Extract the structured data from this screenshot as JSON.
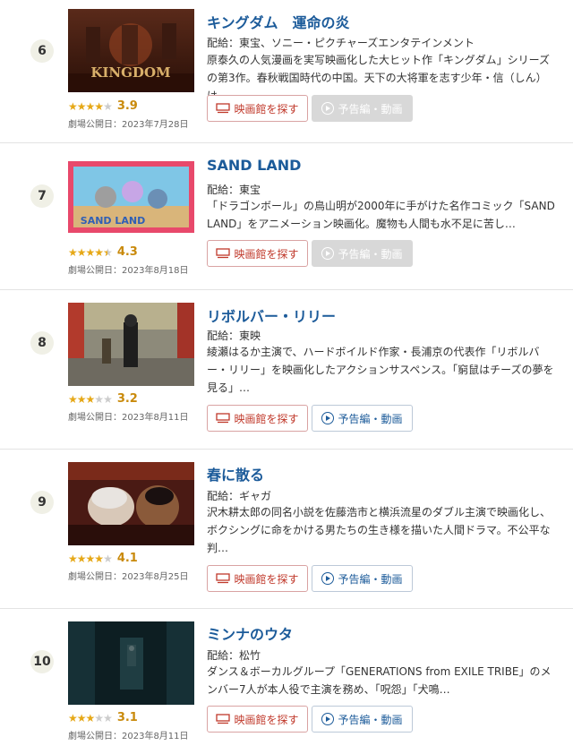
{
  "buttons": {
    "theater": "映画館を探す",
    "trailer": "予告編・動画"
  },
  "items": [
    {
      "rank": "6",
      "title": "キングダム　運命の炎",
      "distributor": "配給：東宝、ソニー・ピクチャーズエンタテインメント",
      "description": "原泰久の人気漫画を実写映画化した大ヒット作「キングダム」シリーズの第3作。春秋戦国時代の中国。天下の大将軍を志す少年・信（しん）は…",
      "score": "3.9",
      "rating": 3.9,
      "date": "劇場公開日：2023年7月28日",
      "trailer_available": false,
      "poster_text": "KINGDOM"
    },
    {
      "rank": "7",
      "title": "SAND LAND",
      "distributor": "配給：東宝",
      "description": "「ドラゴンボール」の鳥山明が2000年に手がけた名作コミック「SAND LAND」をアニメーション映画化。魔物も人間も水不足に苦し…",
      "score": "4.3",
      "rating": 4.3,
      "date": "劇場公開日：2023年8月18日",
      "trailer_available": false,
      "poster_text": "SAND LAND"
    },
    {
      "rank": "8",
      "title": "リボルバー・リリー",
      "distributor": "配給：東映",
      "description": "綾瀬はるか主演で、ハードボイルド作家・長浦京の代表作「リボルバー・リリー」を映画化したアクションサスペンス。「窮鼠はチーズの夢を見る」…",
      "score": "3.2",
      "rating": 3.2,
      "date": "劇場公開日：2023年8月11日",
      "trailer_available": true,
      "poster_text": ""
    },
    {
      "rank": "9",
      "title": "春に散る",
      "distributor": "配給：ギャガ",
      "description": "沢木耕太郎の同名小説を佐藤浩市と横浜流星のダブル主演で映画化し、ボクシングに命をかける男たちの生き様を描いた人間ドラマ。不公平な判…",
      "score": "4.1",
      "rating": 4.1,
      "date": "劇場公開日：2023年8月25日",
      "trailer_available": true,
      "poster_text": ""
    },
    {
      "rank": "10",
      "title": "ミンナのウタ",
      "distributor": "配給：松竹",
      "description": "ダンス＆ボーカルグループ「GENERATIONS from EXILE TRIBE」のメンバー7人が本人役で主演を務め、「呪怨」「犬鳴…",
      "score": "3.1",
      "rating": 3.1,
      "date": "劇場公開日：2023年8月11日",
      "trailer_available": true,
      "poster_text": ""
    }
  ]
}
